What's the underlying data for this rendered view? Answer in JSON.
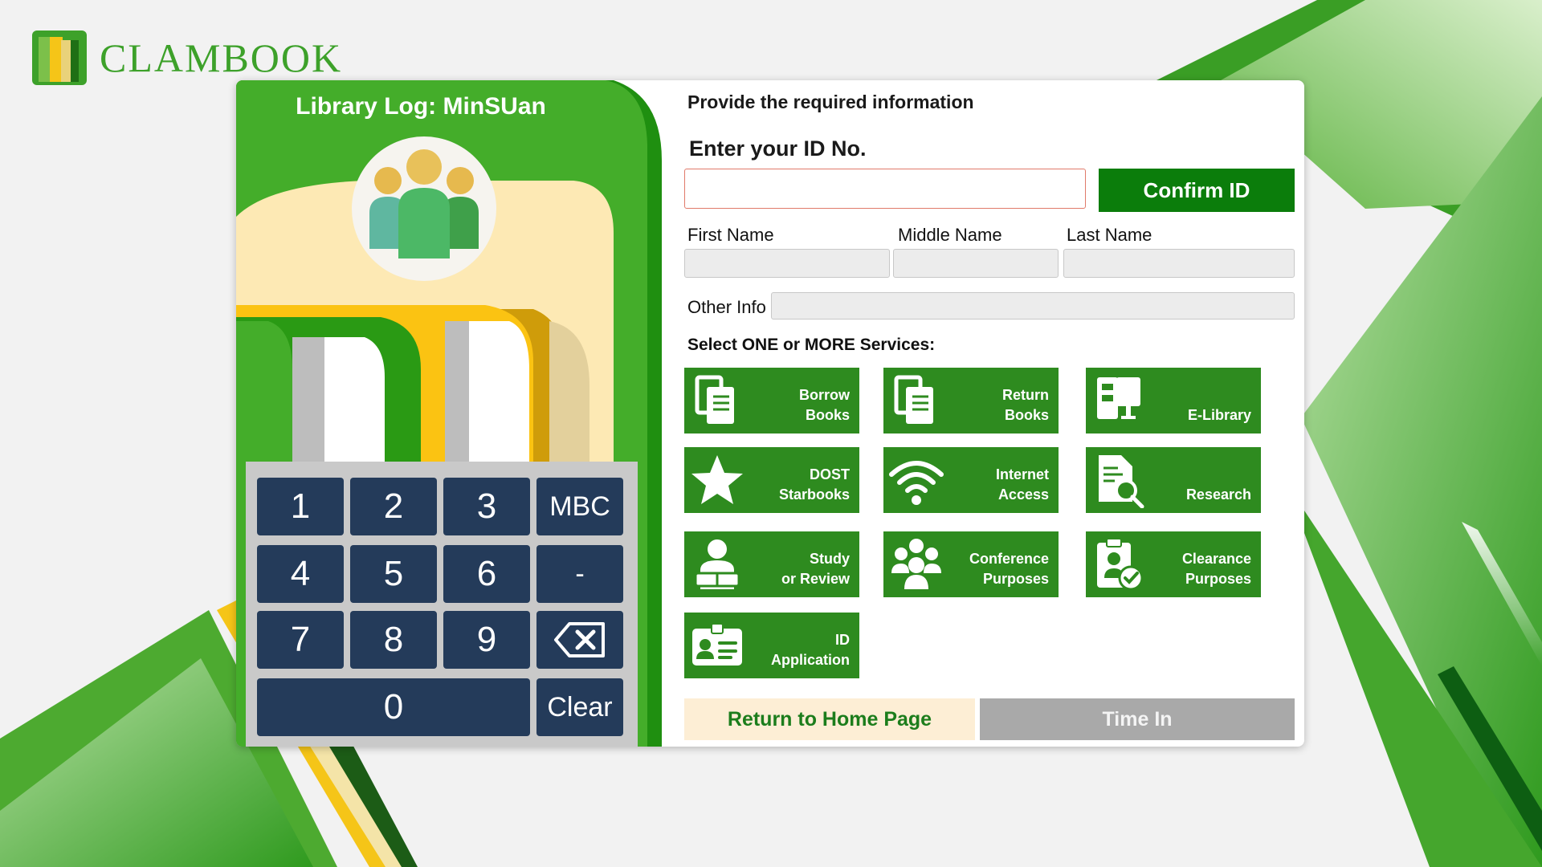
{
  "app": {
    "logo_text": "CLAMBOOK"
  },
  "panel": {
    "title": "Library Log: MinSUan"
  },
  "keypad": {
    "keys": [
      "1",
      "2",
      "3",
      "MBC",
      "4",
      "5",
      "6",
      "-",
      "7",
      "8",
      "9",
      "backspace",
      "0",
      "Clear"
    ]
  },
  "form": {
    "heading": "Provide the required information",
    "id_label": "Enter your ID No.",
    "id_value": "",
    "confirm_label": "Confirm ID",
    "first_name_label": "First Name",
    "middle_name_label": "Middle Name",
    "last_name_label": "Last Name",
    "other_info_label": "Other Info",
    "first_name_value": "",
    "middle_name_value": "",
    "last_name_value": "",
    "other_info_value": ""
  },
  "services": {
    "label": "Select ONE or MORE Services:",
    "items": [
      {
        "label": "Borrow\nBooks",
        "icon": "books-icon"
      },
      {
        "label": "Return\nBooks",
        "icon": "books-return-icon"
      },
      {
        "label": "E-Library",
        "icon": "computer-icon"
      },
      {
        "label": "DOST\nStarbooks",
        "icon": "star-icon"
      },
      {
        "label": "Internet\nAccess",
        "icon": "wifi-icon"
      },
      {
        "label": "Research",
        "icon": "document-search-icon"
      },
      {
        "label": "Study\nor Review",
        "icon": "reader-icon"
      },
      {
        "label": "Conference\nPurposes",
        "icon": "group-icon"
      },
      {
        "label": "Clearance\nPurposes",
        "icon": "clipboard-check-icon"
      },
      {
        "label": "ID\nApplication",
        "icon": "id-card-icon"
      }
    ]
  },
  "footer": {
    "home_label": "Return to Home Page",
    "timein_label": "Time In"
  },
  "colors": {
    "brand_green": "#2e8b1f",
    "confirm_green": "#0b7d0b",
    "keypad_navy": "#243b5a",
    "home_bg": "#fdeed5",
    "disabled_gray": "#a9a9a9"
  }
}
